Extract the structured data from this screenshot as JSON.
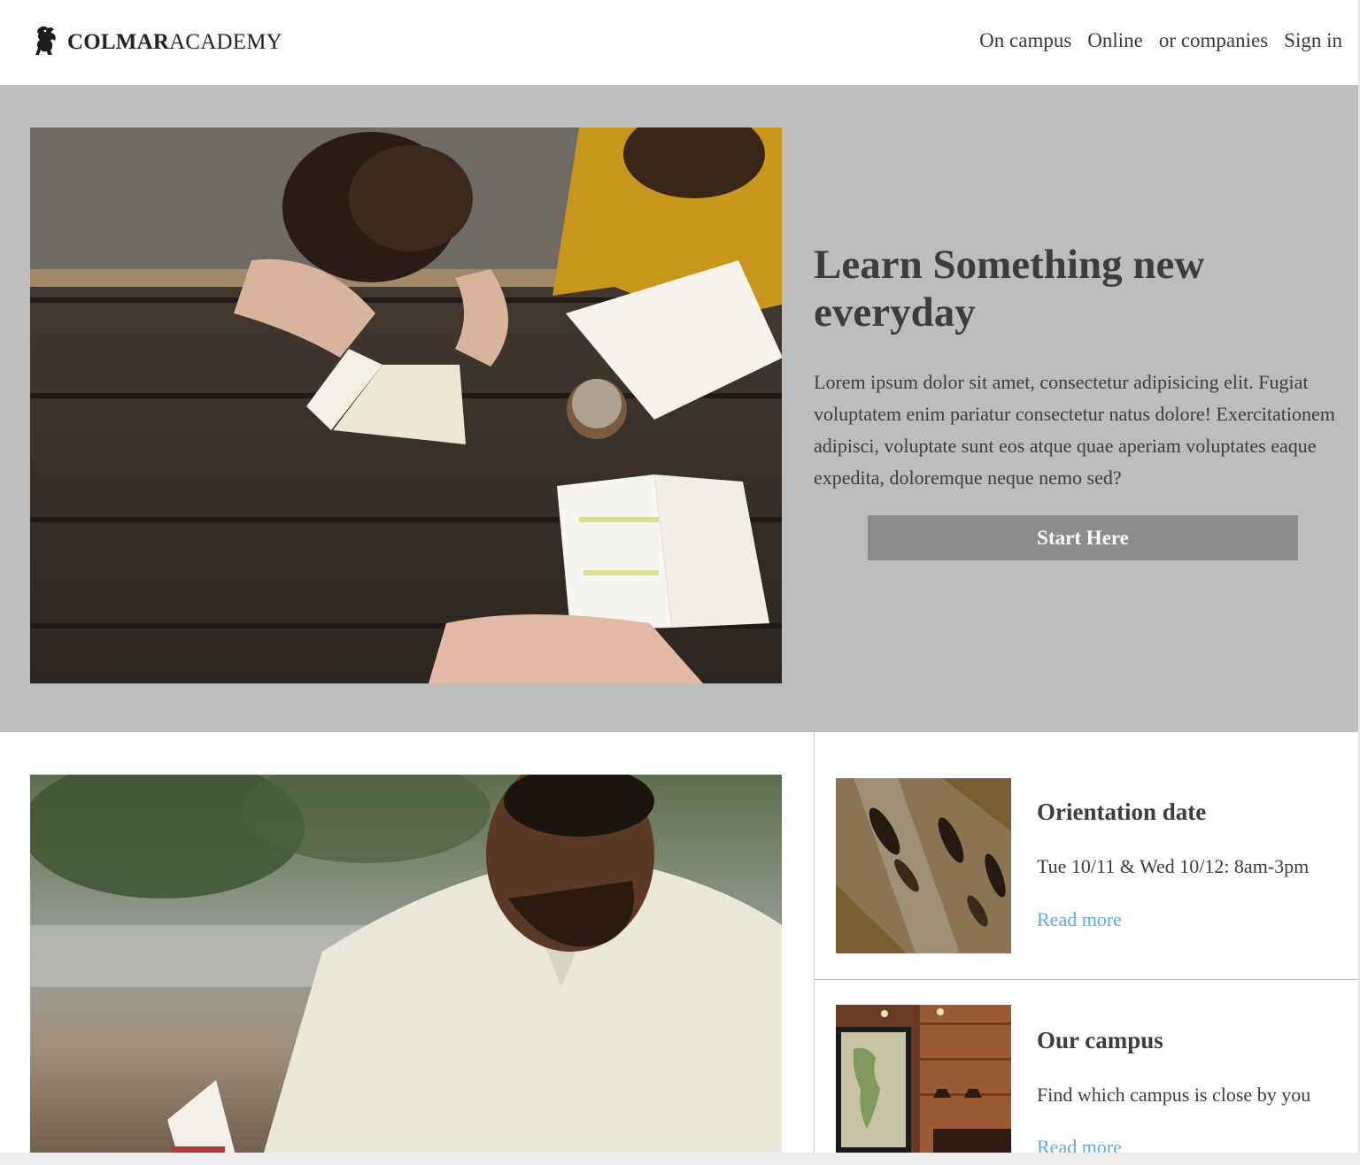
{
  "header": {
    "logo_bold": "COLMAR",
    "logo_regular": "ACADEMY",
    "nav": [
      {
        "label": "On campus"
      },
      {
        "label": "Online"
      },
      {
        "label": "or companies"
      },
      {
        "label": "Sign in"
      }
    ]
  },
  "hero": {
    "title": "Learn Something new everyday",
    "text": "Lorem ipsum dolor sit amet, consectetur adipisicing elit. Fugiat voluptatem enim pariatur consectetur natus dolore! Exercitationem adipisci, voluptate sunt eos atque quae aperiam voluptates eaque expedita, doloremque neque nemo sed?",
    "button_label": "Start Here"
  },
  "cards": [
    {
      "title": "Orientation date",
      "text": "Tue 10/11 & Wed 10/12: 8am-3pm",
      "link_label": "Read more"
    },
    {
      "title": "Our campus",
      "text": "Find which campus is close by you",
      "link_label": "Read more"
    }
  ],
  "colors": {
    "hero_bg": "#bdbdbd",
    "button_bg": "#8c8c8c",
    "link": "#5fa7e6",
    "text": "#3d3d3d"
  }
}
